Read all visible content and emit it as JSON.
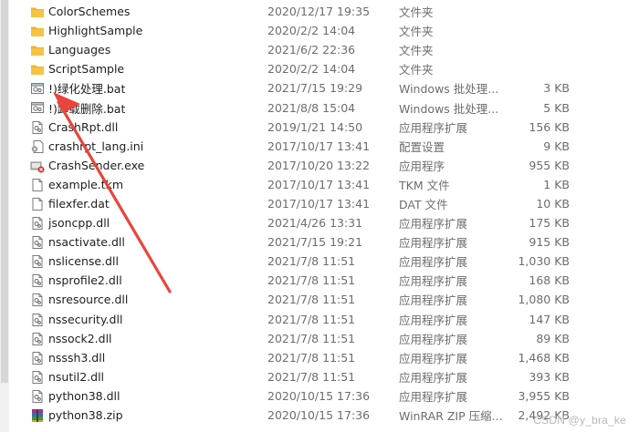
{
  "files": [
    {
      "name": "ColorSchemes",
      "date": "2020/12/17 19:35",
      "type": "文件夹",
      "size": "",
      "icon": "folder-icon"
    },
    {
      "name": "HighlightSample",
      "date": "2020/2/2 14:04",
      "type": "文件夹",
      "size": "",
      "icon": "folder-icon"
    },
    {
      "name": "Languages",
      "date": "2021/6/2 22:36",
      "type": "文件夹",
      "size": "",
      "icon": "folder-icon"
    },
    {
      "name": "ScriptSample",
      "date": "2020/2/2 14:04",
      "type": "文件夹",
      "size": "",
      "icon": "folder-icon"
    },
    {
      "name": "!)绿化处理.bat",
      "date": "2021/7/15 19:29",
      "type": "Windows 批处理...",
      "size": "3 KB",
      "icon": "batch-file-icon"
    },
    {
      "name": "!)卸载删除.bat",
      "date": "2021/8/8 15:04",
      "type": "Windows 批处理...",
      "size": "5 KB",
      "icon": "batch-file-icon"
    },
    {
      "name": "CrashRpt.dll",
      "date": "2019/1/21 14:50",
      "type": "应用程序扩展",
      "size": "156 KB",
      "icon": "dll-file-icon"
    },
    {
      "name": "crashrpt_lang.ini",
      "date": "2017/10/17 13:41",
      "type": "配置设置",
      "size": "9 KB",
      "icon": "config-file-icon"
    },
    {
      "name": "CrashSender.exe",
      "date": "2017/10/20 13:22",
      "type": "应用程序",
      "size": "955 KB",
      "icon": "exe-file-icon"
    },
    {
      "name": "example.tkm",
      "date": "2017/10/17 13:41",
      "type": "TKM 文件",
      "size": "1 KB",
      "icon": "generic-file-icon"
    },
    {
      "name": "filexfer.dat",
      "date": "2017/10/17 13:41",
      "type": "DAT 文件",
      "size": "10 KB",
      "icon": "generic-file-icon"
    },
    {
      "name": "jsoncpp.dll",
      "date": "2021/4/26 13:31",
      "type": "应用程序扩展",
      "size": "175 KB",
      "icon": "dll-file-icon"
    },
    {
      "name": "nsactivate.dll",
      "date": "2021/7/15 19:21",
      "type": "应用程序扩展",
      "size": "915 KB",
      "icon": "dll-file-icon"
    },
    {
      "name": "nslicense.dll",
      "date": "2021/7/8 11:51",
      "type": "应用程序扩展",
      "size": "1,030 KB",
      "icon": "dll-file-icon"
    },
    {
      "name": "nsprofile2.dll",
      "date": "2021/7/8 11:51",
      "type": "应用程序扩展",
      "size": "168 KB",
      "icon": "dll-file-icon"
    },
    {
      "name": "nsresource.dll",
      "date": "2021/7/8 11:51",
      "type": "应用程序扩展",
      "size": "1,080 KB",
      "icon": "dll-file-icon"
    },
    {
      "name": "nssecurity.dll",
      "date": "2021/7/8 11:51",
      "type": "应用程序扩展",
      "size": "147 KB",
      "icon": "dll-file-icon"
    },
    {
      "name": "nssock2.dll",
      "date": "2021/7/8 11:51",
      "type": "应用程序扩展",
      "size": "89 KB",
      "icon": "dll-file-icon"
    },
    {
      "name": "nsssh3.dll",
      "date": "2021/7/8 11:51",
      "type": "应用程序扩展",
      "size": "1,468 KB",
      "icon": "dll-file-icon"
    },
    {
      "name": "nsutil2.dll",
      "date": "2021/7/8 11:51",
      "type": "应用程序扩展",
      "size": "393 KB",
      "icon": "dll-file-icon"
    },
    {
      "name": "python38.dll",
      "date": "2020/10/15 17:36",
      "type": "应用程序扩展",
      "size": "3,955 KB",
      "icon": "dll-file-icon"
    },
    {
      "name": "python38.zip",
      "date": "2020/10/15 17:36",
      "type": "WinRAR ZIP 压缩...",
      "size": "2,492 KB",
      "icon": "winrar-zip-icon"
    }
  ],
  "watermark": "CSDN @y_bra_ke",
  "colors": {
    "folder": "#f6c342",
    "arrow": "#e8453c"
  }
}
